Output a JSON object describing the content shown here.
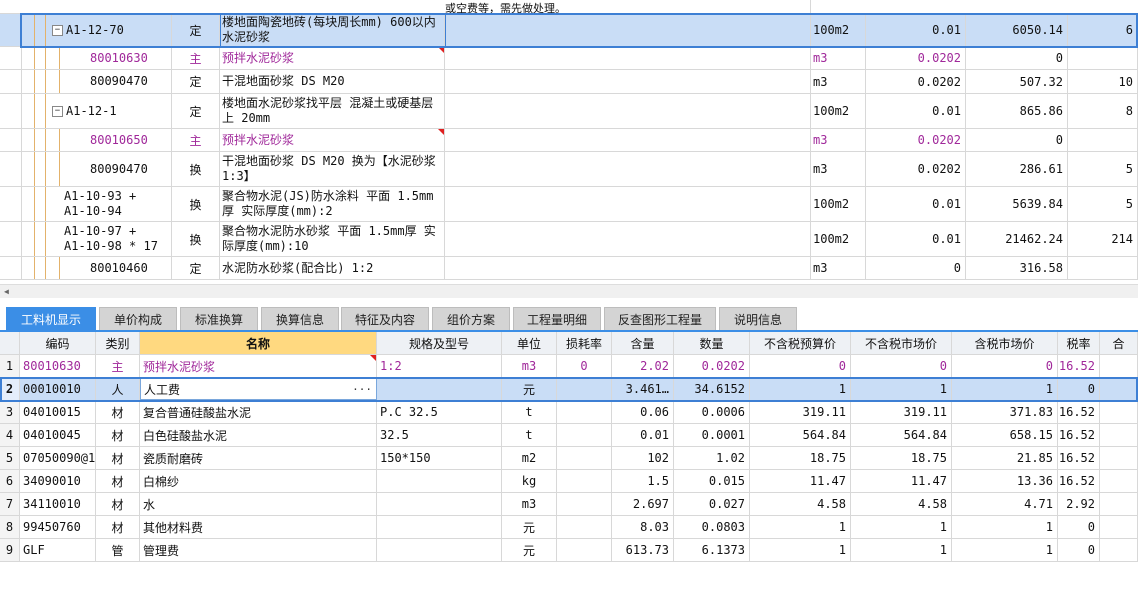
{
  "upper": {
    "top_fragment": "或空费等，需先做处理。",
    "rows": [
      {
        "code": "A1-12-70",
        "type": "定",
        "name": "楼地面陶瓷地砖(每块周长mm) 600以内 水泥砂浆",
        "unit": "100m2",
        "qty": "0.01",
        "price": "6050.14",
        "total": "6",
        "indent": 1,
        "expander": true,
        "purple": false
      },
      {
        "code": "80010630",
        "type": "主",
        "name": "预拌水泥砂浆",
        "unit": "m3",
        "qty": "0.0202",
        "price": "0",
        "total": "",
        "indent": 2,
        "expander": false,
        "purple": true
      },
      {
        "code": "80090470",
        "type": "定",
        "name": "干混地面砂浆 DS M20",
        "unit": "m3",
        "qty": "0.0202",
        "price": "507.32",
        "total": "10",
        "indent": 2,
        "expander": false,
        "purple": false
      },
      {
        "code": "A1-12-1",
        "type": "定",
        "name": "楼地面水泥砂浆找平层 混凝土或硬基层上 20mm",
        "unit": "100m2",
        "qty": "0.01",
        "price": "865.86",
        "total": "8",
        "indent": 1,
        "expander": true,
        "purple": false
      },
      {
        "code": "80010650",
        "type": "主",
        "name": "预拌水泥砂浆",
        "unit": "m3",
        "qty": "0.0202",
        "price": "0",
        "total": "",
        "indent": 2,
        "expander": false,
        "purple": true
      },
      {
        "code": "80090470",
        "type": "换",
        "name": "干混地面砂浆 DS M20  换为【水泥砂浆1:3】",
        "unit": "m3",
        "qty": "0.0202",
        "price": "286.61",
        "total": "5",
        "indent": 2,
        "expander": false,
        "purple": false
      },
      {
        "code": "A1-10-93 +\nA1-10-94",
        "type": "换",
        "name": "聚合物水泥(JS)防水涂料 平面 1.5mm厚  实际厚度(mm):2",
        "unit": "100m2",
        "qty": "0.01",
        "price": "5639.84",
        "total": "5",
        "indent": 1,
        "expander": false,
        "purple": false
      },
      {
        "code": "A1-10-97 +\nA1-10-98 * 17",
        "type": "换",
        "name": "聚合物水泥防水砂浆 平面 1.5mm厚  实际厚度(mm):10",
        "unit": "100m2",
        "qty": "0.01",
        "price": "21462.24",
        "total": "214",
        "indent": 1,
        "expander": false,
        "purple": false
      },
      {
        "code": "80010460",
        "type": "定",
        "name": "水泥防水砂浆(配合比) 1:2",
        "unit": "m3",
        "qty": "0",
        "price": "316.58",
        "total": "",
        "indent": 2,
        "expander": false,
        "purple": false
      }
    ]
  },
  "tabs": [
    "工料机显示",
    "单价构成",
    "标准换算",
    "换算信息",
    "特征及内容",
    "组价方案",
    "工程量明细",
    "反查图形工程量",
    "说明信息"
  ],
  "lower": {
    "headers": [
      "编码",
      "类别",
      "名称",
      "规格及型号",
      "单位",
      "损耗率",
      "含量",
      "数量",
      "不含税预算价",
      "不含税市场价",
      "含税市场价",
      "税率",
      "合"
    ],
    "rows": [
      {
        "num": "1",
        "code": "80010630",
        "type": "主",
        "name": "预拌水泥砂浆",
        "spec": "1:2",
        "unit": "m3",
        "loss": "0",
        "content": "2.02",
        "qty": "0.0202",
        "budget": "0",
        "market": "0",
        "taxmarket": "0",
        "rate": "16.52",
        "purple": true
      },
      {
        "num": "2",
        "code": "00010010",
        "type": "人",
        "name": "人工费",
        "spec": "",
        "unit": "元",
        "loss": "",
        "content": "3.461…",
        "qty": "34.6152",
        "budget": "1",
        "market": "1",
        "taxmarket": "1",
        "rate": "0",
        "purple": false
      },
      {
        "num": "3",
        "code": "04010015",
        "type": "材",
        "name": "复合普通硅酸盐水泥",
        "spec": "P.C 32.5",
        "unit": "t",
        "loss": "",
        "content": "0.06",
        "qty": "0.0006",
        "budget": "319.11",
        "market": "319.11",
        "taxmarket": "371.83",
        "rate": "16.52",
        "purple": false
      },
      {
        "num": "4",
        "code": "04010045",
        "type": "材",
        "name": "白色硅酸盐水泥",
        "spec": "32.5",
        "unit": "t",
        "loss": "",
        "content": "0.01",
        "qty": "0.0001",
        "budget": "564.84",
        "market": "564.84",
        "taxmarket": "658.15",
        "rate": "16.52",
        "purple": false
      },
      {
        "num": "5",
        "code": "07050090@1",
        "type": "材",
        "name": "瓷质耐磨砖",
        "spec": "150*150",
        "unit": "m2",
        "loss": "",
        "content": "102",
        "qty": "1.02",
        "budget": "18.75",
        "market": "18.75",
        "taxmarket": "21.85",
        "rate": "16.52",
        "purple": false
      },
      {
        "num": "6",
        "code": "34090010",
        "type": "材",
        "name": "白棉纱",
        "spec": "",
        "unit": "kg",
        "loss": "",
        "content": "1.5",
        "qty": "0.015",
        "budget": "11.47",
        "market": "11.47",
        "taxmarket": "13.36",
        "rate": "16.52",
        "purple": false
      },
      {
        "num": "7",
        "code": "34110010",
        "type": "材",
        "name": "水",
        "spec": "",
        "unit": "m3",
        "loss": "",
        "content": "2.697",
        "qty": "0.027",
        "budget": "4.58",
        "market": "4.58",
        "taxmarket": "4.71",
        "rate": "2.92",
        "purple": false
      },
      {
        "num": "8",
        "code": "99450760",
        "type": "材",
        "name": "其他材料费",
        "spec": "",
        "unit": "元",
        "loss": "",
        "content": "8.03",
        "qty": "0.0803",
        "budget": "1",
        "market": "1",
        "taxmarket": "1",
        "rate": "0",
        "purple": false
      },
      {
        "num": "9",
        "code": "GLF",
        "type": "管",
        "name": "管理费",
        "spec": "",
        "unit": "元",
        "loss": "",
        "content": "613.73",
        "qty": "6.1373",
        "budget": "1",
        "market": "1",
        "taxmarket": "1",
        "rate": "0",
        "purple": false
      }
    ],
    "ellipsis_button": "···"
  }
}
